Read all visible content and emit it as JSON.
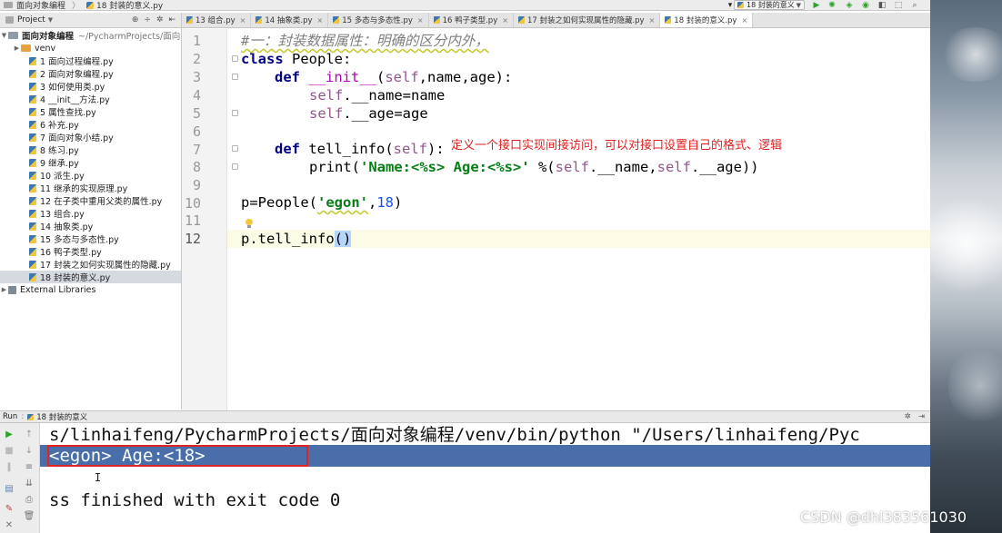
{
  "navbar": {
    "project": "面向对象编程",
    "file": "18 封装的意义.py",
    "run_config": "18 封装的意义"
  },
  "project_panel": {
    "title": "Project",
    "root": {
      "name": "面向对象编程",
      "path": "~/PycharmProjects/面向"
    },
    "items": [
      {
        "label": "venv",
        "kind": "folder"
      },
      {
        "label": "1 面向过程编程.py",
        "kind": "file"
      },
      {
        "label": "2 面向对象编程.py",
        "kind": "file"
      },
      {
        "label": "3 如何使用类.py",
        "kind": "file"
      },
      {
        "label": "4 __init__方法.py",
        "kind": "file"
      },
      {
        "label": "5 属性查找.py",
        "kind": "file"
      },
      {
        "label": "6 补充.py",
        "kind": "file"
      },
      {
        "label": "7 面向对象小结.py",
        "kind": "file"
      },
      {
        "label": "8 练习.py",
        "kind": "file"
      },
      {
        "label": "9 继承.py",
        "kind": "file"
      },
      {
        "label": "10 派生.py",
        "kind": "file"
      },
      {
        "label": "11 继承的实现原理.py",
        "kind": "file"
      },
      {
        "label": "12 在子类中重用父类的属性.py",
        "kind": "file"
      },
      {
        "label": "13 组合.py",
        "kind": "file"
      },
      {
        "label": "14 抽象类.py",
        "kind": "file"
      },
      {
        "label": "15 多态与多态性.py",
        "kind": "file"
      },
      {
        "label": "16 鸭子类型.py",
        "kind": "file"
      },
      {
        "label": "17 封装之如何实现属性的隐藏.py",
        "kind": "file"
      },
      {
        "label": "18 封装的意义.py",
        "kind": "file",
        "selected": true
      }
    ],
    "external": "External Libraries"
  },
  "tabs": [
    {
      "label": "13 组合.py"
    },
    {
      "label": "14 抽象类.py"
    },
    {
      "label": "15 多态与多态性.py"
    },
    {
      "label": "16 鸭子类型.py"
    },
    {
      "label": "17 封装之如何实现属性的隐藏.py"
    },
    {
      "label": "18 封装的意义.py",
      "active": true
    }
  ],
  "editor": {
    "line_numbers": [
      "1",
      "2",
      "3",
      "4",
      "5",
      "6",
      "7",
      "8",
      "9",
      "10",
      "11",
      "12"
    ],
    "code": {
      "l1": "#一：封装数据属性：明确的区分内外，",
      "l2_kw": "class",
      "l2_rest": " People:",
      "l3_kw": "def",
      "l3_name": "__init__",
      "l3_open": "(",
      "l3_self": "self",
      "l3_rest": ",name,age):",
      "l4_self": "self",
      "l4_rest": ".__name=name",
      "l5_self": "self",
      "l5_rest": ".__age=age",
      "l7_kw": "def",
      "l7_name": " tell_info(",
      "l7_self": "self",
      "l7_rest": "):",
      "l8_a": "print(",
      "l8_str": "'Name:<%s> Age:<%s>'",
      "l8_b": " %(",
      "l8_self1": "self",
      "l8_c": ".__name,",
      "l8_self2": "self",
      "l8_d": ".__age))",
      "l10_a": "p=People(",
      "l10_str": "'egon'",
      "l10_b": ",",
      "l10_num": "18",
      "l10_c": ")",
      "l12_a": "p.tell_info",
      "l12_paren": "()"
    },
    "annotation": "定义一个接口实现间接访问，可以对接口设置自己的格式、逻辑"
  },
  "run": {
    "label": "Run",
    "config": "18 封装的意义",
    "output": [
      "s/linhaifeng/PycharmProjects/面向对象编程/venv/bin/python \"/Users/linhaifeng/Pyc",
      "<egon> Age:<18>",
      "",
      "ss finished with exit code 0"
    ]
  },
  "watermark": "CSDN @dhl383561030",
  "colors": {
    "keyword": "#000080",
    "self": "#94558d",
    "string": "#067d17",
    "number": "#1750eb",
    "annotation": "#e02020",
    "console_highlight": "#4a6ea9",
    "red_box": "#e02424"
  }
}
